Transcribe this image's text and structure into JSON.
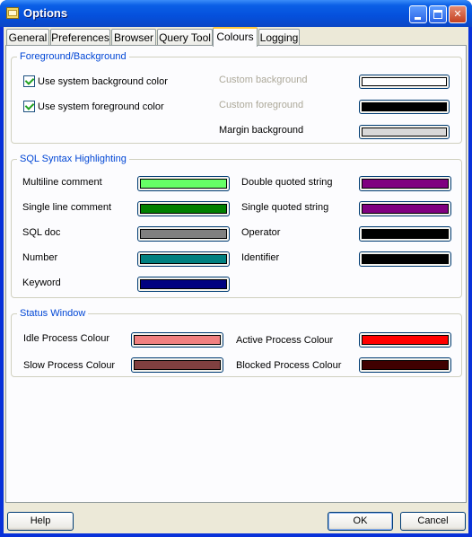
{
  "window": {
    "title": "Options"
  },
  "tabs": [
    "General",
    "Preferences",
    "Browser",
    "Query Tool",
    "Colours",
    "Logging"
  ],
  "fg_bg": {
    "title": "Foreground/Background",
    "use_system_bg": "Use system background color",
    "use_system_fg": "Use system foreground color",
    "custom_bg_label": "Custom background",
    "custom_fg_label": "Custom foreground",
    "margin_bg_label": "Margin background",
    "custom_bg_color": "#ffffff",
    "custom_fg_color": "#000000",
    "margin_bg_color": "#d8d8d8"
  },
  "syntax": {
    "title": "SQL Syntax Highlighting",
    "items": [
      {
        "label": "Multiline comment",
        "color": "#66ff66"
      },
      {
        "label": "Single line comment",
        "color": "#008000"
      },
      {
        "label": "SQL doc",
        "color": "#808080"
      },
      {
        "label": "Number",
        "color": "#008080"
      },
      {
        "label": "Keyword",
        "color": "#000080"
      },
      {
        "label": "Double quoted string",
        "color": "#800080"
      },
      {
        "label": "Single quoted string",
        "color": "#800080"
      },
      {
        "label": "Operator",
        "color": "#000000"
      },
      {
        "label": "Identifier",
        "color": "#000000"
      }
    ]
  },
  "status": {
    "title": "Status Window",
    "items": [
      {
        "label": "Idle Process Colour",
        "color": "#f08080"
      },
      {
        "label": "Slow Process Colour",
        "color": "#804040"
      },
      {
        "label": "Active Process Colour",
        "color": "#ff0000"
      },
      {
        "label": "Blocked Process Colour",
        "color": "#400000"
      }
    ]
  },
  "buttons": {
    "help": "Help",
    "ok": "OK",
    "cancel": "Cancel"
  }
}
